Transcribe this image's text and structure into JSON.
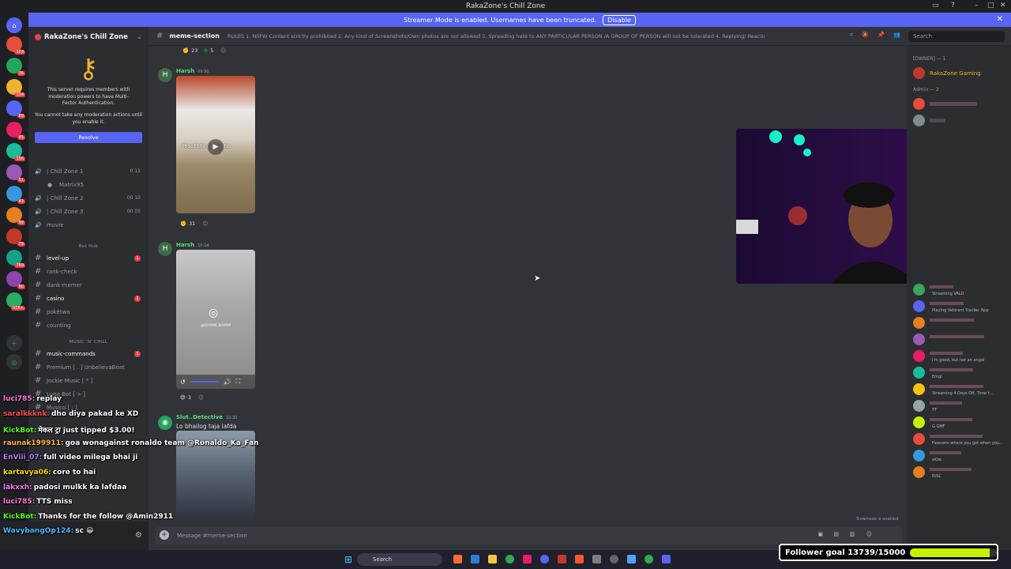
{
  "window": {
    "title": "RakaZone's Chill Zone"
  },
  "streamer_banner": {
    "text": "Streamer Mode is enabled. Usernames have been truncated.",
    "button": "Disable"
  },
  "guild_badges": [
    "103",
    "36",
    "134",
    "89",
    "45",
    "156",
    "51",
    "43",
    "99",
    "79",
    "789",
    "90",
    "91K+"
  ],
  "server": {
    "name": "RakaZone's Chill Zone"
  },
  "mfa": {
    "line1": "This server requires members with moderation powers to have Multi-Factor Authentication.",
    "line2": "You cannot take any moderation actions until you enable it.",
    "button": "Resolve"
  },
  "channels": {
    "voice": [
      {
        "name": "| Chill Zone 1",
        "count": "0 11"
      },
      {
        "name": "Matrix95"
      },
      {
        "name": "| Chill Zone 2",
        "count": "00 10"
      },
      {
        "name": "| Chill Zone 3",
        "count": "00 05"
      },
      {
        "name": "movie"
      }
    ],
    "cat_bot_hub": "Bot Hub",
    "bot_hub": [
      {
        "name": "level-up",
        "badge": "1"
      },
      {
        "name": "rank-check"
      },
      {
        "name": "dank-memer"
      },
      {
        "name": "casino",
        "badge": "1"
      },
      {
        "name": "pokétwo"
      },
      {
        "name": "counting"
      }
    ],
    "cat_music": "MUSIC 'N' CHILL",
    "music": [
      {
        "name": "music-commands",
        "badge": "1"
      },
      {
        "name": "Premium [ . ] UnbelievaBoat"
      },
      {
        "name": "Jockie Music [ * ]"
      },
      {
        "name": "Luna Bot [ > ]"
      },
      {
        "name": "Musico [ ; ]"
      }
    ]
  },
  "channel_header": {
    "name": "meme-section",
    "topic": "RULES 1. NSFW Content strictly prohibited 2. Any kind of Screenshots/Own photos are not allowed 3. Spreading hate to ANY PARTICULAR PERSON /A GROUP OF PERSON will not be tolerated 4. Replying/ Reacting with a picture on any Meme is not allowed. 5. M...",
    "search_placeholder": "Search"
  },
  "messages": [
    {
      "top_reactions": [
        "23",
        "5"
      ]
    },
    {
      "author": "Harsh",
      "time": "09:50",
      "media_caption": "Proof bhi de dekho",
      "reactions": [
        "31"
      ]
    },
    {
      "author": "Harsh",
      "time": "10:14",
      "media_caption": "@SHYAM_SHYAM",
      "reactions": [
        "3"
      ]
    },
    {
      "author": "Slut..Detective",
      "time": "10:30",
      "text": "Lo bhailog taja lafda"
    }
  ],
  "composer": {
    "placeholder": "Message #meme-section",
    "slowmode": "Slowmode is enabled."
  },
  "members": {
    "owner_header": "[OWNER] — 1",
    "owner": {
      "name": "RakaZone Gaming",
      "color": "#f0b232"
    },
    "admin_header": "Admin — 2",
    "list": [
      {
        "status": "Streaming VALO",
        "color": "#3ba55d"
      },
      {
        "status": "Playing Valorant Tracker App",
        "color": "#5865f2"
      },
      {
        "status": "",
        "color": "#e67e22"
      },
      {
        "status": "",
        "color": "#9b59b6"
      },
      {
        "status": "I'm good, but not an angel",
        "color": "#e91e63"
      },
      {
        "status": "Emgi",
        "color": "#1abc9c"
      },
      {
        "status": "Streaming 4 Days Off, Time t...",
        "color": "#f1c40f"
      },
      {
        "status": "YT",
        "color": "#95a5a6"
      },
      {
        "status": "G GMF",
        "color": "#c6f200"
      },
      {
        "status": "Heavens where you get when you...",
        "color": "#e74c3c"
      },
      {
        "status": "wOw",
        "color": "#3498db"
      },
      {
        "status": "R/SC",
        "color": "#e67e22"
      }
    ]
  },
  "stream_chat": [
    {
      "user": "luci785:",
      "msg": "replay",
      "color": "#ff7ad9"
    },
    {
      "user": "saralkkknk:",
      "msg": "dho diya pakad ke XD",
      "color": "#ff4d4d"
    },
    {
      "user": "KickBot:",
      "msg": "मेकल ट्रा just tipped $3.00!",
      "color": "#53fc18"
    },
    {
      "user": "raunak199911:",
      "msg": "goa wonagainst ronaldo team @Ronaldo_Ka_Fan",
      "color": "#ffb347"
    },
    {
      "user": "EnViii_07:",
      "msg": "full video milega bhai ji",
      "color": "#b57cff"
    },
    {
      "user": "kartavya06:",
      "msg": "core to hai",
      "color": "#ffd700"
    },
    {
      "user": "lakxxh:",
      "msg": "padosi mulkk ka lafdaa",
      "color": "#ff77ff"
    },
    {
      "user": "luci785:",
      "msg": "TTS miss",
      "color": "#ff7ad9"
    },
    {
      "user": "KickBot:",
      "msg": "Thanks for the follow @Amin2911",
      "color": "#53fc18"
    },
    {
      "user": "WavybangOp124:",
      "msg": "sc 😀",
      "color": "#4db8ff"
    }
  ],
  "follower_goal": {
    "label": "Follower goal 13739/15000",
    "current": 13739,
    "goal": 15000
  },
  "taskbar": {
    "search": "Search"
  }
}
